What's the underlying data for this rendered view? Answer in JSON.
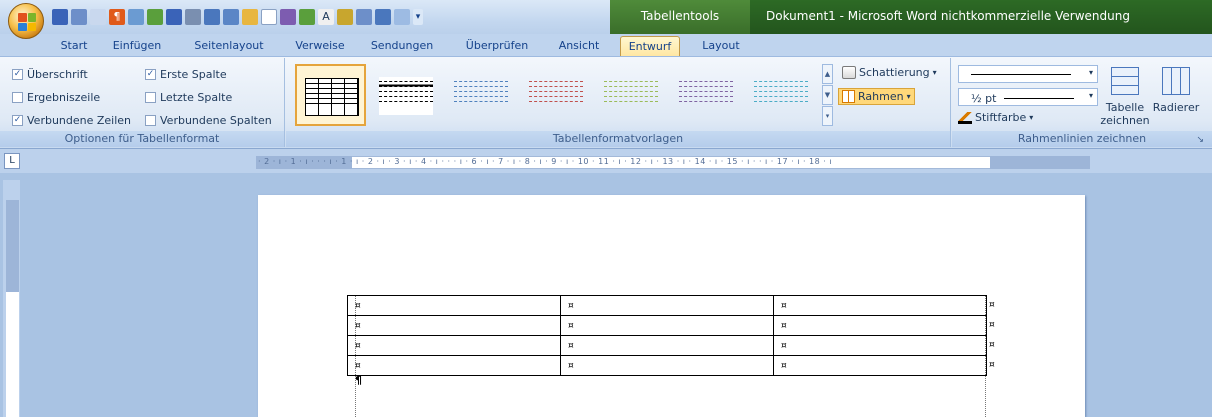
{
  "window": {
    "context_tab_label": "Tabellentools",
    "title": "Dokument1 - Microsoft Word nichtkommerzielle Verwendung"
  },
  "tabs": [
    "Start",
    "Einfügen",
    "Seitenlayout",
    "Verweise",
    "Sendungen",
    "Überprüfen",
    "Ansicht",
    "Entwurf",
    "Layout"
  ],
  "active_tab": "Entwurf",
  "options_group": {
    "label": "Optionen für Tabellenformat",
    "checkboxes": [
      {
        "label": "Überschrift",
        "checked": true
      },
      {
        "label": "Ergebniszeile",
        "checked": false
      },
      {
        "label": "Verbundene Zeilen",
        "checked": true
      },
      {
        "label": "Erste Spalte",
        "checked": true
      },
      {
        "label": "Letzte Spalte",
        "checked": false
      },
      {
        "label": "Verbundene Spalten",
        "checked": false
      }
    ]
  },
  "styles_group": {
    "label": "Tabellenformatvorlagen",
    "shading_label": "Schattierung",
    "borders_label": "Rahmen",
    "gallery_colors": [
      "#333333",
      "#000000",
      "#4f81bd",
      "#c0504d",
      "#9bbb59",
      "#8064a2",
      "#4bacc6"
    ]
  },
  "draw_group": {
    "label": "Rahmenlinien zeichnen",
    "weight_value": "½ pt",
    "pen_color_label": "Stiftfarbe",
    "draw_table_label_1": "Tabelle",
    "draw_table_label_2": "zeichnen",
    "eraser_label": "Radierer"
  },
  "ruler": {
    "text": "· 2 · ı · 1 · ı ·  ·  · ı · 1 · ı · 2 · ı · 3 · ı · 4 · ı ·  ·  · ı · 6 · ı · 7 · ı · 8 · ı · 9 · ı · 10 ·  11 · ı · 12 · ı · 13 · ı · 14 · ı · 15 · ı ·  · ı · 17 · ı · 18 · ı",
    "corner_glyph": "L"
  },
  "document": {
    "cell_mark": "¤",
    "paragraph_mark": "¶",
    "rows": [
      [
        "¤",
        "¤",
        "¤"
      ],
      [
        "¤",
        "¤",
        "¤"
      ],
      [
        "¤",
        "¤",
        "¤"
      ],
      [
        "¤",
        "¤",
        "¤"
      ]
    ]
  }
}
